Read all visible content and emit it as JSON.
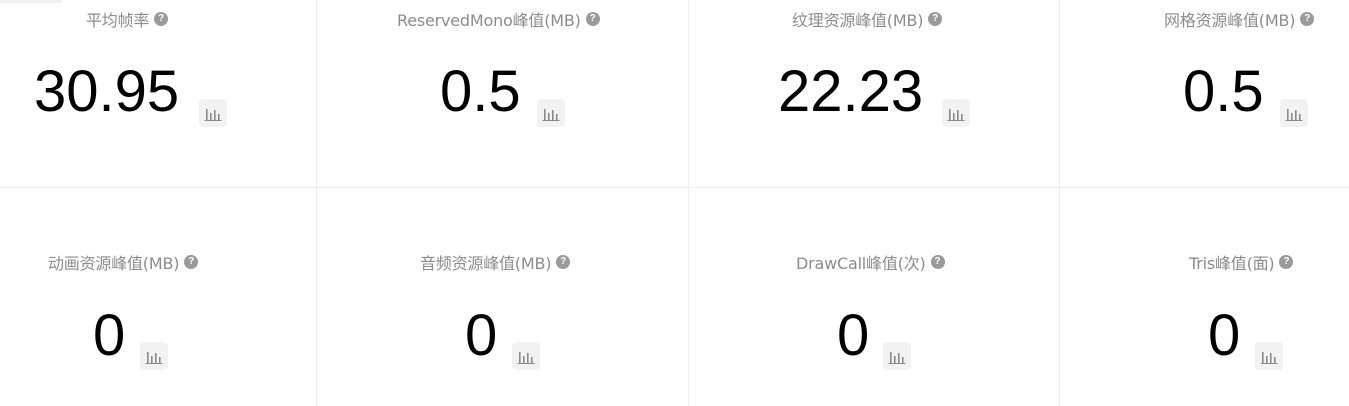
{
  "metrics": [
    {
      "label": "平均帧率",
      "value": "30.95"
    },
    {
      "label": "ReservedMono峰值(MB)",
      "value": "0.5"
    },
    {
      "label": "纹理资源峰值(MB)",
      "value": "22.23"
    },
    {
      "label": "网格资源峰值(MB)",
      "value": "0.5"
    },
    {
      "label": "动画资源峰值(MB)",
      "value": "0"
    },
    {
      "label": "音频资源峰值(MB)",
      "value": "0"
    },
    {
      "label": "DrawCall峰值(次)",
      "value": "0"
    },
    {
      "label": "Tris峰值(面)",
      "value": "0"
    }
  ],
  "help_glyph": "?",
  "icons": {
    "help": "question-circle-icon",
    "chart": "bar-chart-icon"
  }
}
